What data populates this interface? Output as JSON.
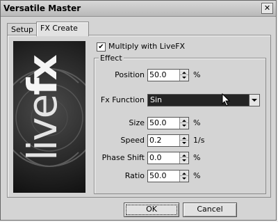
{
  "window": {
    "title": "Versatile Master",
    "close_glyph": "✕"
  },
  "tabs": [
    {
      "label": "Setup",
      "active": false
    },
    {
      "label": "FX Create",
      "active": true
    }
  ],
  "banner": {
    "logo_live": "live",
    "logo_fx": "fx"
  },
  "multiply": {
    "label": "Multiply with LiveFX",
    "checked": true,
    "check_glyph": "✔"
  },
  "effect": {
    "group_title": "Effect",
    "position": {
      "label": "Position",
      "value": "50.0",
      "unit": "%"
    },
    "fx_function": {
      "label": "Fx Function",
      "value": "Sin"
    },
    "size": {
      "label": "Size",
      "value": "50.0",
      "unit": "%"
    },
    "speed": {
      "label": "Speed",
      "value": "0.2",
      "unit": "1/s"
    },
    "phase_shift": {
      "label": "Phase Shift",
      "value": "0.0",
      "unit": "%"
    },
    "ratio": {
      "label": "Ratio",
      "value": "50.0",
      "unit": "%"
    }
  },
  "buttons": {
    "ok": "OK",
    "cancel": "Cancel"
  },
  "icons": {
    "close": "close-icon",
    "checkbox": "check-icon",
    "dropdown": "chevron-down-icon",
    "cursor": "mouse-pointer-icon"
  }
}
